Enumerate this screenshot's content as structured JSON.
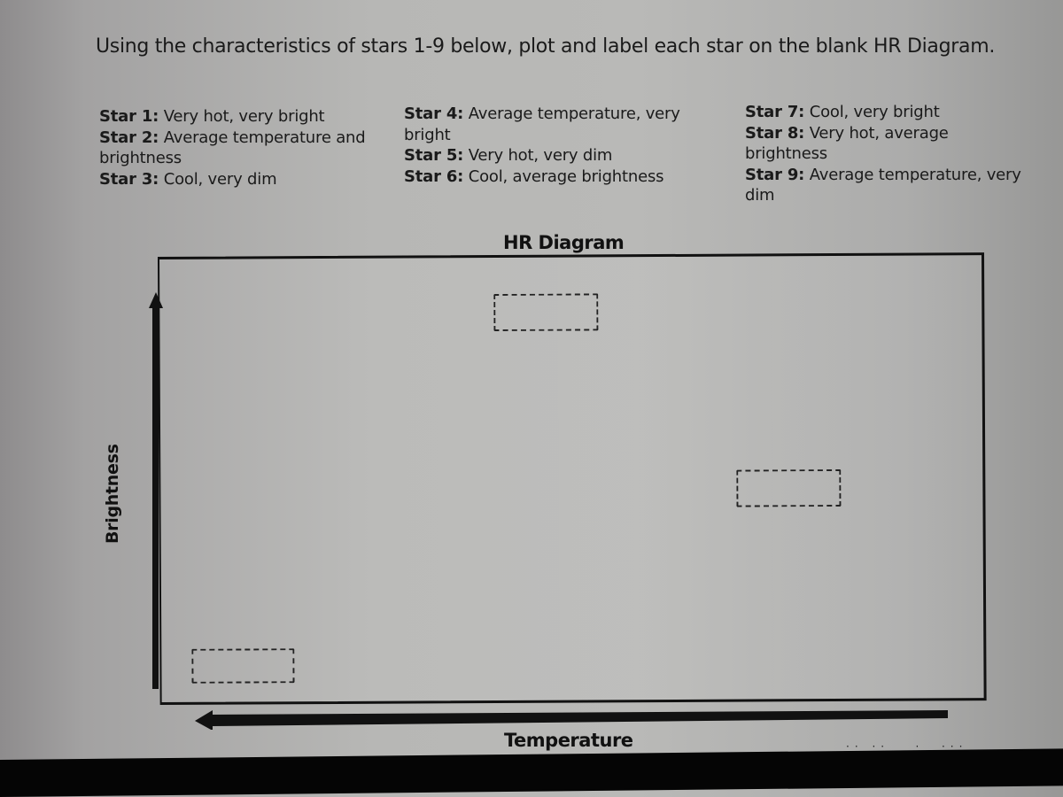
{
  "instructions": "Using the characteristics of stars 1-9 below, plot and label each star on the blank HR Diagram.",
  "stars": [
    {
      "label": "Star 1:",
      "description": " Very hot, very bright"
    },
    {
      "label": "Star 2:",
      "description": " Average temperature and brightness"
    },
    {
      "label": "Star 3:",
      "description": " Cool, very dim"
    },
    {
      "label": "Star 4:",
      "description": " Average temperature, very bright"
    },
    {
      "label": "Star 5:",
      "description": " Very hot, very dim"
    },
    {
      "label": "Star 6:",
      "description": " Cool, average brightness"
    },
    {
      "label": "Star 7:",
      "description": " Cool, very bright"
    },
    {
      "label": "Star 8:",
      "description": " Very hot, average brightness"
    },
    {
      "label": "Star 9:",
      "description": " Average temperature, very dim"
    }
  ],
  "diagram": {
    "title": "HR Diagram",
    "y_axis_label": "Brightness",
    "x_axis_label": "Temperature",
    "label_boxes_count": 3
  },
  "colors": {
    "ink": "#111111",
    "paper": "#b8b8b6"
  }
}
